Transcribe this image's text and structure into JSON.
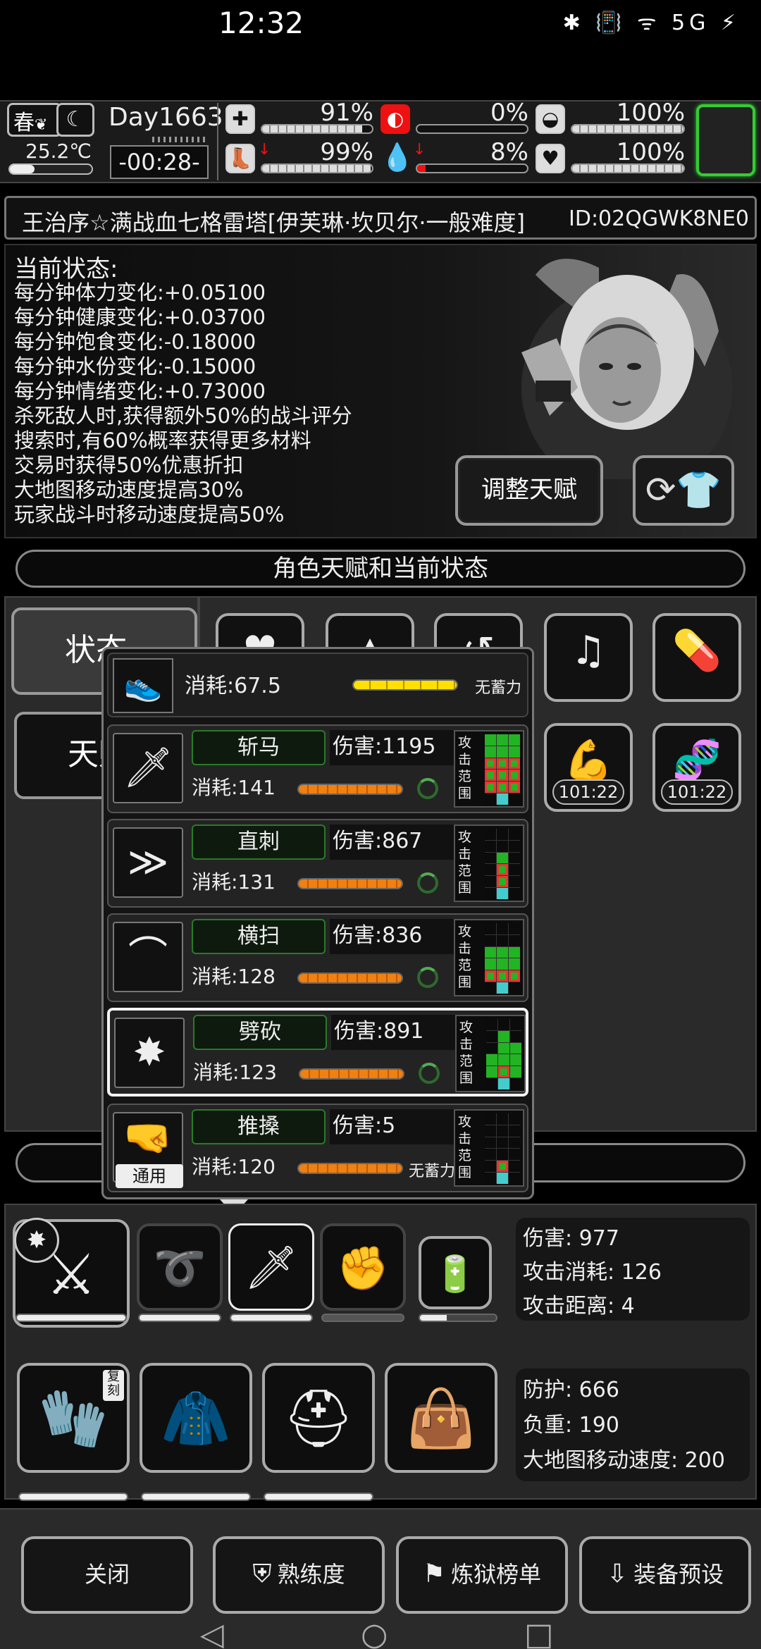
{
  "statusbar": {
    "time": "12:32",
    "icons": "✱ 📳 ᯤ 5G ⚡"
  },
  "hud": {
    "season": "春",
    "temperature": "25.2℃",
    "day": "Day1663",
    "clock": "-00:28-",
    "stats": [
      {
        "name": "stamina",
        "pct": "91%",
        "fill": 0.91
      },
      {
        "name": "hunger",
        "pct": "0%",
        "fill": 0.0
      },
      {
        "name": "armor",
        "pct": "100%",
        "fill": 1.0
      },
      {
        "name": "legs",
        "pct": "99%",
        "fill": 0.99
      },
      {
        "name": "blood",
        "pct": "8%",
        "fill": 0.08
      },
      {
        "name": "mood",
        "pct": "100%",
        "fill": 1.0
      }
    ]
  },
  "title": {
    "name": "王治序☆满战血七格雷塔[伊芙琳·坎贝尔·一般难度]",
    "id": "ID:02QGWK8NE0"
  },
  "status": {
    "heading": "当前状态:",
    "lines": [
      "每分钟体力变化:+0.05100",
      "每分钟健康变化:+0.03700",
      "每分钟饱食变化:-0.18000",
      "每分钟水份变化:-0.15000",
      "每分钟情绪变化:+0.73000",
      "杀死敌人时,获得额外50%的战斗评分",
      "搜索时,有60%概率获得更多材料",
      "交易时获得50%优惠折扣",
      "大地图移动速度提高30%",
      "玩家战斗时移动速度提高50%"
    ],
    "adjust_talent": "调整天赋"
  },
  "section_title": "角色天赋和当前状态",
  "tabs": {
    "status": "状态",
    "talent": "天赋"
  },
  "grid_timers": [
    "101:22",
    "101:22"
  ],
  "popup": {
    "kick_cost": "消耗:67.5",
    "no_charge": "无蓄力",
    "skills": [
      {
        "name": "斩马",
        "damage": "伤害:1195",
        "cost": "消耗:141",
        "icon": "slash-horse-icon"
      },
      {
        "name": "直刺",
        "damage": "伤害:867",
        "cost": "消耗:131",
        "icon": "thrust-icon"
      },
      {
        "name": "横扫",
        "damage": "伤害:836",
        "cost": "消耗:128",
        "icon": "sweep-icon"
      },
      {
        "name": "劈砍",
        "damage": "伤害:891",
        "cost": "消耗:123",
        "icon": "chop-icon"
      },
      {
        "name": "推搡",
        "damage": "伤害:5",
        "cost": "消耗:120",
        "icon": "shove-icon"
      }
    ],
    "range_label": "攻击范围",
    "common_tag": "通用"
  },
  "weapon_info": {
    "damage": "伤害: 977",
    "cost": "攻击消耗: 126",
    "range": "攻击距离: 4"
  },
  "armor_info": {
    "defense": "防护: 666",
    "weight": "负重: 190",
    "speed": "大地图移动速度: 200"
  },
  "copy_tag": "复刻",
  "nav": {
    "close": "关闭",
    "proficiency": "熟练度",
    "ranking": "炼狱榜单",
    "preset": "装备预设"
  }
}
